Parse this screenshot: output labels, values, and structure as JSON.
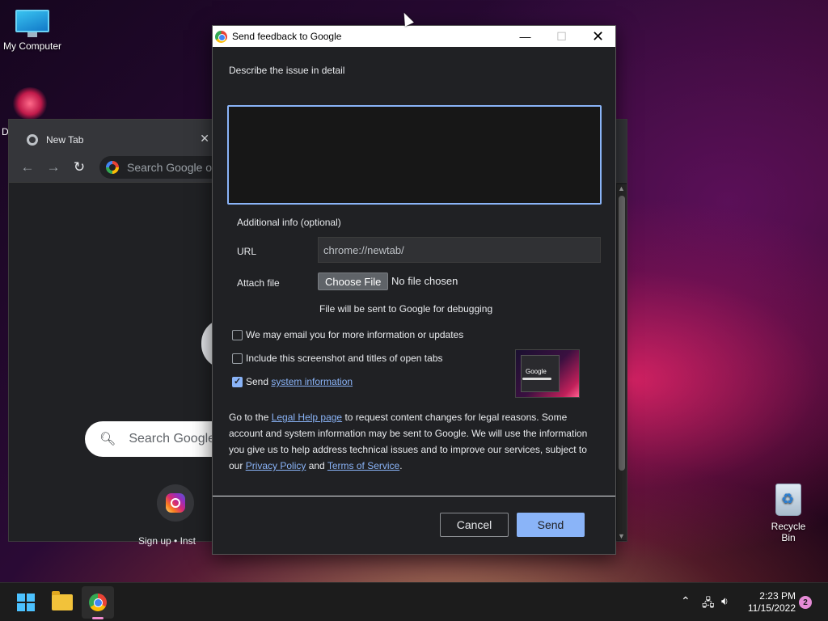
{
  "desktop": {
    "my_computer_label": "My Computer",
    "partial_icon_label": "D",
    "recycle_bin_label": "Recycle Bin"
  },
  "chrome_window": {
    "tab_title": "New Tab",
    "tab_close": "✕",
    "omnibox_placeholder": "Search Google or",
    "ntp_search_placeholder": "Search Google",
    "shortcut_label": "Sign up • Inst"
  },
  "feedback_dialog": {
    "window_title": "Send feedback to Google",
    "describe_label": "Describe the issue in detail",
    "additional_info_label": "Additional info (optional)",
    "url_label": "URL",
    "url_value": "chrome://newtab/",
    "attach_file_label": "Attach file",
    "choose_file_label": "Choose File",
    "no_file_text": "No file chosen",
    "debug_note": "File will be sent to Google for debugging",
    "checkboxes": {
      "email": {
        "label": "We may email you for more information or updates",
        "checked": false
      },
      "screenshot": {
        "label": "Include this screenshot and titles of open tabs",
        "checked": false
      },
      "system_info": {
        "prefix": "Send",
        "link": "system information",
        "checked": true
      }
    },
    "legal": {
      "part1": "Go to the ",
      "legal_help_link": "Legal Help page",
      "part2": " to request content changes for legal reasons. Some account and system information may be sent to Google. We will use the information you give us to help address technical issues and to improve our services, subject to our ",
      "privacy_link": "Privacy Policy",
      "part3": " and ",
      "terms_link": "Terms of Service",
      "part4": "."
    },
    "thumbnail_text": "Google",
    "cancel_label": "Cancel",
    "send_label": "Send"
  },
  "taskbar": {
    "clock_time": "2:23 PM",
    "clock_date": "11/15/2022",
    "notification_count": "2"
  },
  "colors": {
    "dialog_bg": "#202124",
    "accent": "#8ab4f8",
    "taskbar_bg": "#1c1c1c"
  }
}
